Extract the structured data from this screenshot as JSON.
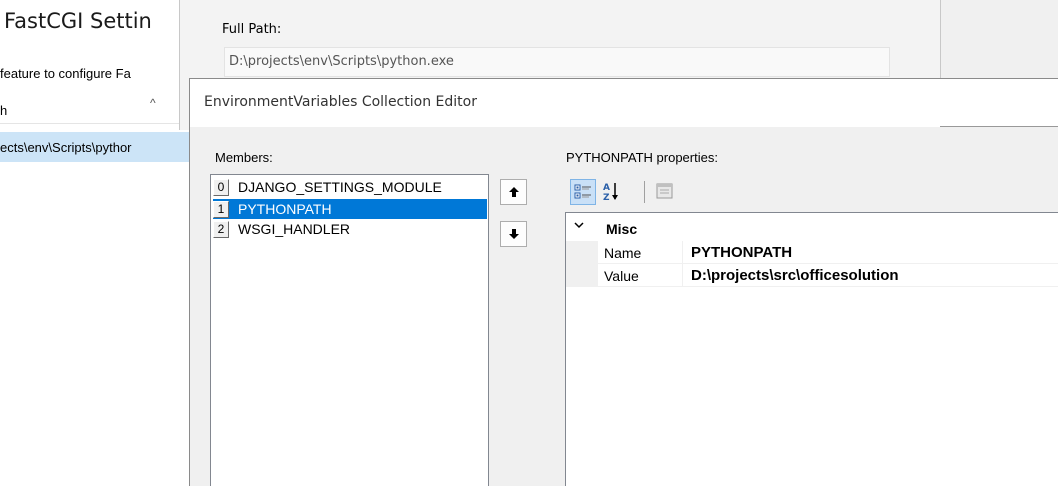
{
  "background_window": {
    "title": "FastCGI Settin",
    "description": "feature to configure Fa",
    "column_header": "h",
    "sort_glyph": "^",
    "selected_row": "ects\\env\\Scripts\\pythor"
  },
  "edit_dialog": {
    "full_path_label": "Full Path:",
    "full_path_value": "D:\\projects\\env\\Scripts\\python.exe"
  },
  "collection_editor": {
    "title": "EnvironmentVariables Collection Editor",
    "members_label": "Members:",
    "members": [
      {
        "index": "0",
        "name": "DJANGO_SETTINGS_MODULE",
        "selected": false
      },
      {
        "index": "1",
        "name": "PYTHONPATH",
        "selected": true
      },
      {
        "index": "2",
        "name": "WSGI_HANDLER",
        "selected": false
      }
    ],
    "move_up_glyph": "🡅",
    "move_down_glyph": "🡇",
    "properties_label": "PYTHONPATH  properties:",
    "toolbar": {
      "categorized_icon": "categorized-icon",
      "alphabetical_icon": "alphabetical-icon",
      "property_pages_icon": "property-pages-icon"
    },
    "grid": {
      "category": "Misc",
      "rows": [
        {
          "name": "Name",
          "value": "PYTHONPATH"
        },
        {
          "name": "Value",
          "value": "D:\\projects\\src\\officesolution"
        }
      ]
    }
  },
  "colors": {
    "selection": "#0078d7",
    "background_selection": "#cce4f7"
  }
}
